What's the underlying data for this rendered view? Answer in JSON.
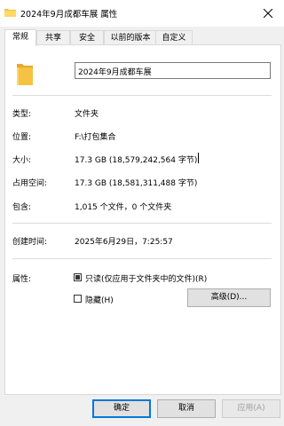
{
  "window": {
    "title": "2024年9月成都车展 属性"
  },
  "tabs": [
    {
      "label": "常规"
    },
    {
      "label": "共享"
    },
    {
      "label": "安全"
    },
    {
      "label": "以前的版本"
    },
    {
      "label": "自定义"
    }
  ],
  "general": {
    "folder_name": "2024年9月成都车展",
    "type_label": "类型:",
    "type_value": "文件夹",
    "location_label": "位置:",
    "location_value": "F:\\打包集合",
    "size_label": "大小:",
    "size_value": "17.3 GB (18,579,242,564 字节)",
    "size_on_disk_label": "占用空间:",
    "size_on_disk_value": "17.3 GB (18,581,311,488 字节)",
    "contains_label": "包含:",
    "contains_value": "1,015 个文件，0 个文件夹",
    "created_label": "创建时间:",
    "created_value": "2025年6月29日，7:25:57",
    "attributes_label": "属性:",
    "readonly_label": "只读(仅应用于文件夹中的文件)(R)",
    "readonly_state": "indeterminate",
    "hidden_label": "隐藏(H)",
    "hidden_checked": false,
    "advanced_label": "高级(D)..."
  },
  "footer": {
    "ok_label": "确定",
    "cancel_label": "取消",
    "apply_label": "应用(A)"
  },
  "icons": {
    "window_icon": "folder-icon",
    "folder_big": "folder-icon",
    "close": "close-icon"
  },
  "colors": {
    "folder_yellow": "#f5c242",
    "accent_blue": "#0078d7"
  }
}
